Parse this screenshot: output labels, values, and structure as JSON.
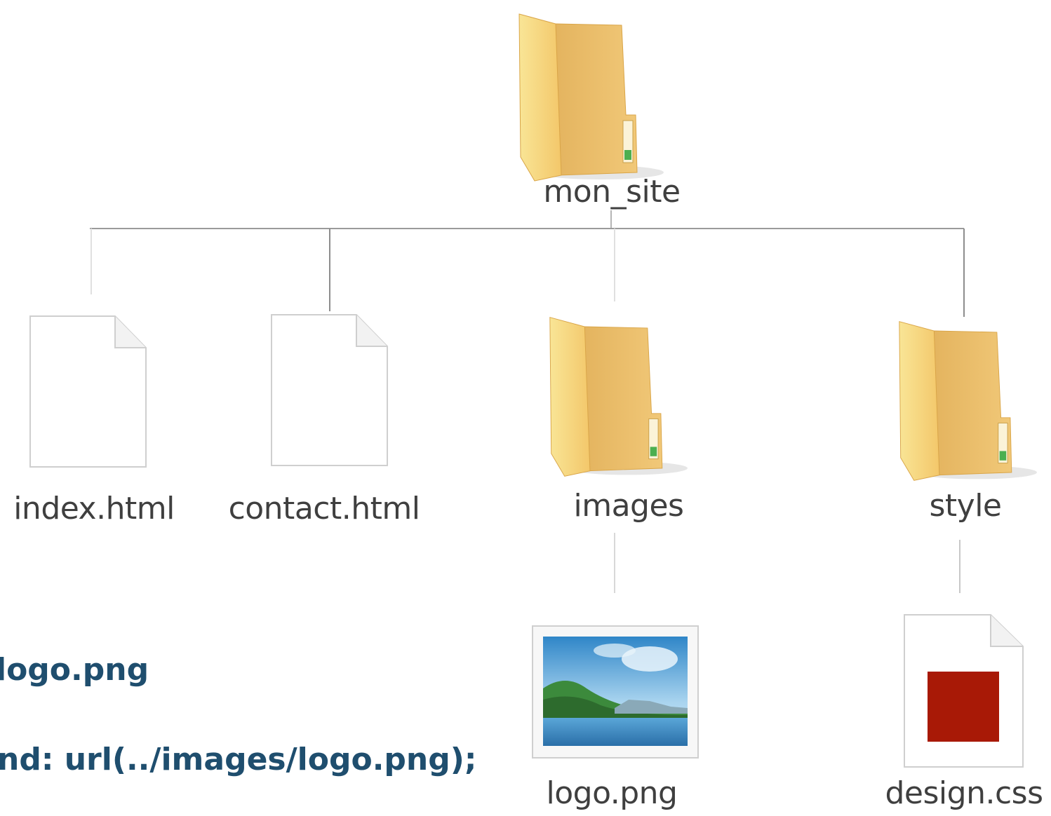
{
  "root": {
    "label": "mon_site",
    "type": "folder"
  },
  "children": [
    {
      "label": "index.html",
      "type": "file"
    },
    {
      "label": "contact.html",
      "type": "file"
    },
    {
      "label": "images",
      "type": "folder",
      "children": [
        {
          "label": "logo.png",
          "type": "image"
        }
      ]
    },
    {
      "label": "style",
      "type": "folder",
      "children": [
        {
          "label": "design.css",
          "type": "css"
        }
      ]
    }
  ],
  "code_snippet": {
    "line1": "logo.png",
    "line2": "nd: url(../images/logo.png);"
  },
  "colors": {
    "folder": "#f7d77e",
    "folder_dark": "#e8b65a",
    "line": "#9a9a9a",
    "label": "#3f3f3f",
    "code": "#1f4e6e",
    "css_square": "#a81906"
  }
}
